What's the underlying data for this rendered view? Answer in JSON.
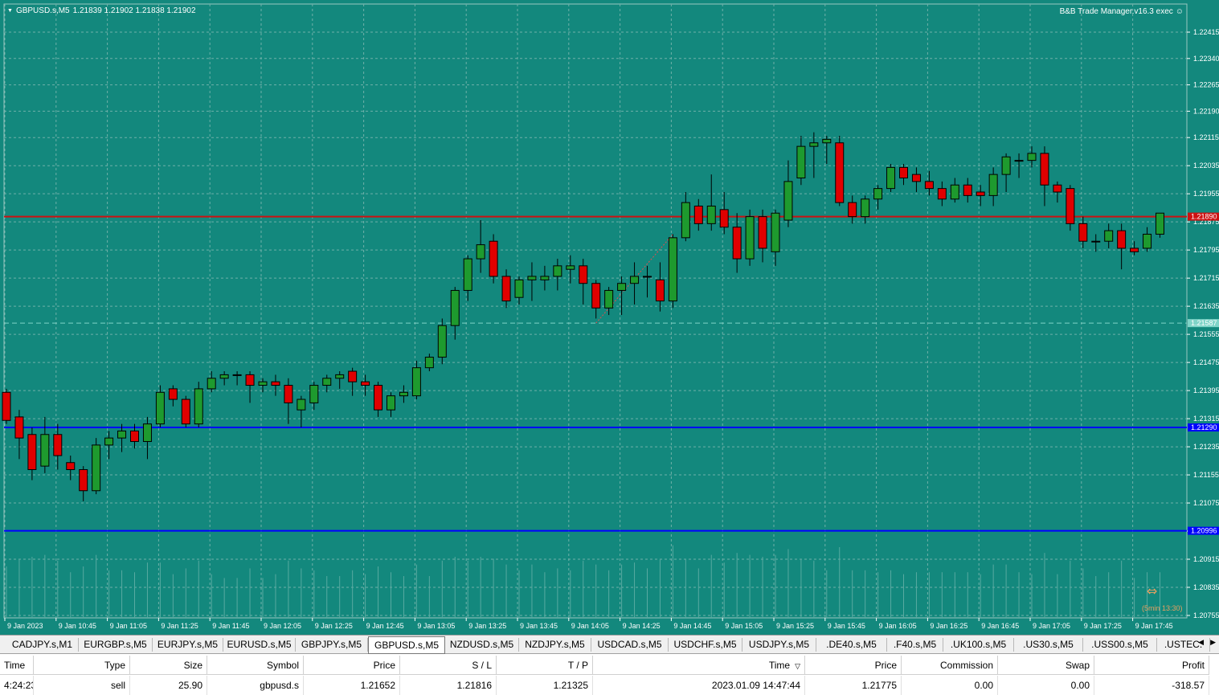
{
  "chart": {
    "symbol": "GBPUSD.s,M5",
    "ohlc": "1.21839 1.21902 1.21838 1.21902",
    "ea_label": "B&B Trade Manager.v16.3 exec",
    "ea_icon": "smiley-icon",
    "bg_color": "#13887d",
    "bull_color": "#1e9a2e",
    "bear_color": "#e00000",
    "countdown": "(5min 13:30)",
    "price_axis_labels": [
      "1.22415",
      "1.22340",
      "1.22265",
      "1.22190",
      "1.22115",
      "1.22035",
      "1.21955",
      "1.21875",
      "1.21795",
      "1.21715",
      "1.21635",
      "1.21555",
      "1.21475",
      "1.21395",
      "1.21315",
      "1.21235",
      "1.21155",
      "1.21075",
      "1.20995",
      "1.20915",
      "1.20835",
      "1.20755"
    ],
    "time_labels": [
      "9 Jan 2023",
      "9 Jan 10:45",
      "9 Jan 11:05",
      "9 Jan 11:25",
      "9 Jan 11:45",
      "9 Jan 12:05",
      "9 Jan 12:25",
      "9 Jan 12:45",
      "9 Jan 13:05",
      "9 Jan 13:25",
      "9 Jan 13:45",
      "9 Jan 14:05",
      "9 Jan 14:25",
      "9 Jan 14:45",
      "9 Jan 15:05",
      "9 Jan 15:25",
      "9 Jan 15:45",
      "9 Jan 16:05",
      "9 Jan 16:25",
      "9 Jan 16:45",
      "9 Jan 17:05",
      "9 Jan 17:25",
      "9 Jan 17:45"
    ],
    "lines": [
      {
        "name": "stop-loss-line",
        "price_label": "1.21890",
        "color": "#cc1111"
      },
      {
        "name": "entry-line",
        "price_label": "1.21587",
        "color": "#7fd4c8"
      },
      {
        "name": "level-line-1",
        "price_label": "1.21290",
        "color": "#0000ff"
      },
      {
        "name": "level-line-2",
        "price_label": "1.20996",
        "color": "#0000ff"
      }
    ]
  },
  "chart_data": {
    "type": "candlestick",
    "timeframe": "M5",
    "x_start": "9 Jan 10:20",
    "ylim": [
      1.2073,
      1.2249
    ],
    "candles": [
      [
        1.2139,
        1.214,
        1.213,
        1.2131
      ],
      [
        1.2132,
        1.2134,
        1.212,
        1.2126
      ],
      [
        1.2127,
        1.2129,
        1.2114,
        1.2117
      ],
      [
        1.2118,
        1.2132,
        1.2116,
        1.2127
      ],
      [
        1.2127,
        1.213,
        1.2117,
        1.2121
      ],
      [
        1.2119,
        1.2121,
        1.2114,
        1.2117
      ],
      [
        1.2117,
        1.2118,
        1.2108,
        1.2111
      ],
      [
        1.2111,
        1.2126,
        1.211,
        1.2124
      ],
      [
        1.2124,
        1.2128,
        1.212,
        1.2126
      ],
      [
        1.2126,
        1.213,
        1.2122,
        1.2128
      ],
      [
        1.2128,
        1.213,
        1.2123,
        1.2125
      ],
      [
        1.2125,
        1.2132,
        1.212,
        1.213
      ],
      [
        1.213,
        1.2141,
        1.2129,
        1.2139
      ],
      [
        1.214,
        1.2141,
        1.2135,
        1.2137
      ],
      [
        1.2137,
        1.2138,
        1.2129,
        1.213
      ],
      [
        1.213,
        1.2142,
        1.2129,
        1.214
      ],
      [
        1.214,
        1.2145,
        1.2139,
        1.2143
      ],
      [
        1.2143,
        1.2145,
        1.2141,
        1.2144
      ],
      [
        1.2144,
        1.2145,
        1.2141,
        1.2144
      ],
      [
        1.2144,
        1.2145,
        1.2136,
        1.2141
      ],
      [
        1.2141,
        1.2143,
        1.2139,
        1.2142
      ],
      [
        1.2142,
        1.2144,
        1.2138,
        1.2141
      ],
      [
        1.2141,
        1.2143,
        1.213,
        1.2136
      ],
      [
        1.2134,
        1.2138,
        1.2129,
        1.2137
      ],
      [
        1.2136,
        1.2142,
        1.2134,
        1.2141
      ],
      [
        1.2141,
        1.2144,
        1.2139,
        1.2143
      ],
      [
        1.2143,
        1.2145,
        1.214,
        1.2144
      ],
      [
        1.2145,
        1.2146,
        1.2138,
        1.2142
      ],
      [
        1.2142,
        1.2144,
        1.2138,
        1.2141
      ],
      [
        1.2141,
        1.2142,
        1.2132,
        1.2134
      ],
      [
        1.2134,
        1.2139,
        1.2132,
        1.2138
      ],
      [
        1.2138,
        1.2141,
        1.2136,
        1.2139
      ],
      [
        1.2138,
        1.2148,
        1.2137,
        1.2146
      ],
      [
        1.2146,
        1.215,
        1.2145,
        1.2149
      ],
      [
        1.2149,
        1.216,
        1.2147,
        1.2158
      ],
      [
        1.2158,
        1.2169,
        1.2154,
        1.2168
      ],
      [
        1.2168,
        1.2178,
        1.2165,
        1.2177
      ],
      [
        1.2177,
        1.2188,
        1.2173,
        1.2181
      ],
      [
        1.2182,
        1.2184,
        1.217,
        1.2172
      ],
      [
        1.2172,
        1.2174,
        1.2163,
        1.2165
      ],
      [
        1.2166,
        1.2172,
        1.2164,
        1.2171
      ],
      [
        1.2171,
        1.2176,
        1.2165,
        1.2172
      ],
      [
        1.2171,
        1.2175,
        1.2168,
        1.2172
      ],
      [
        1.2172,
        1.2177,
        1.2168,
        1.2175
      ],
      [
        1.2174,
        1.2178,
        1.217,
        1.2175
      ],
      [
        1.2175,
        1.2177,
        1.2164,
        1.217
      ],
      [
        1.217,
        1.2171,
        1.216,
        1.2163
      ],
      [
        1.2163,
        1.2169,
        1.2161,
        1.2168
      ],
      [
        1.2168,
        1.2172,
        1.2161,
        1.217
      ],
      [
        1.217,
        1.2176,
        1.2164,
        1.2172
      ],
      [
        1.2172,
        1.2175,
        1.2166,
        1.2172
      ],
      [
        1.2171,
        1.2176,
        1.2162,
        1.2165
      ],
      [
        1.2165,
        1.2184,
        1.2163,
        1.2183
      ],
      [
        1.2183,
        1.2196,
        1.2182,
        1.2193
      ],
      [
        1.2192,
        1.2194,
        1.2185,
        1.2187
      ],
      [
        1.2187,
        1.2201,
        1.2185,
        1.2192
      ],
      [
        1.2191,
        1.2196,
        1.2184,
        1.2186
      ],
      [
        1.2186,
        1.219,
        1.2173,
        1.2177
      ],
      [
        1.2177,
        1.2191,
        1.2175,
        1.2189
      ],
      [
        1.2189,
        1.2191,
        1.2176,
        1.218
      ],
      [
        1.2179,
        1.2191,
        1.2175,
        1.219
      ],
      [
        1.2188,
        1.2205,
        1.2186,
        1.2199
      ],
      [
        1.22,
        1.2212,
        1.2198,
        1.2209
      ],
      [
        1.2209,
        1.2213,
        1.22,
        1.221
      ],
      [
        1.221,
        1.2212,
        1.2204,
        1.2211
      ],
      [
        1.221,
        1.2212,
        1.2192,
        1.2193
      ],
      [
        1.2193,
        1.2195,
        1.2187,
        1.2189
      ],
      [
        1.2189,
        1.2195,
        1.2187,
        1.2194
      ],
      [
        1.2194,
        1.2198,
        1.2191,
        1.2197
      ],
      [
        1.2197,
        1.2204,
        1.2196,
        1.2203
      ],
      [
        1.2203,
        1.2204,
        1.2198,
        1.22
      ],
      [
        1.2201,
        1.2203,
        1.2196,
        1.2199
      ],
      [
        1.2199,
        1.2202,
        1.2195,
        1.2197
      ],
      [
        1.2197,
        1.2199,
        1.2192,
        1.2194
      ],
      [
        1.2194,
        1.22,
        1.2193,
        1.2198
      ],
      [
        1.2198,
        1.22,
        1.2193,
        1.2195
      ],
      [
        1.2196,
        1.2198,
        1.2192,
        1.2195
      ],
      [
        1.2195,
        1.2203,
        1.2192,
        1.2201
      ],
      [
        1.2201,
        1.2207,
        1.2196,
        1.2206
      ],
      [
        1.2205,
        1.2207,
        1.22,
        1.2205
      ],
      [
        1.2205,
        1.2209,
        1.2203,
        1.2207
      ],
      [
        1.2207,
        1.2209,
        1.2192,
        1.2198
      ],
      [
        1.2198,
        1.2199,
        1.2193,
        1.2196
      ],
      [
        1.2197,
        1.2198,
        1.2185,
        1.2187
      ],
      [
        1.2187,
        1.2189,
        1.218,
        1.2182
      ],
      [
        1.2182,
        1.2184,
        1.2179,
        1.2182
      ],
      [
        1.2182,
        1.2187,
        1.218,
        1.2185
      ],
      [
        1.2185,
        1.2187,
        1.2174,
        1.218
      ],
      [
        1.218,
        1.2182,
        1.2178,
        1.2179
      ],
      [
        1.218,
        1.2186,
        1.2179,
        1.2184
      ],
      [
        1.2184,
        1.219,
        1.2183,
        1.219
      ]
    ]
  },
  "tabs": [
    "CADJPY.s,M1",
    "EURGBP.s,M5",
    "EURJPY.s,M5",
    "EURUSD.s,M5",
    "GBPJPY.s,M5",
    "GBPUSD.s,M5",
    "NZDUSD.s,M5",
    "NZDJPY.s,M5",
    "USDCAD.s,M5",
    "USDCHF.s,M5",
    "USDJPY.s,M5",
    ".DE40.s,M5",
    ".F40.s,M5",
    ".UK100.s,M5",
    ".US30.s,M5",
    ".USS00.s,M5",
    ".USTEC."
  ],
  "active_tab": "GBPUSD.s,M5",
  "table": {
    "headers": [
      "Time",
      "Type",
      "Size",
      "Symbol",
      "Price",
      "S / L",
      "T / P",
      "Time",
      "Price",
      "Commission",
      "Swap",
      "Profit"
    ],
    "sort_indicator": "▽",
    "row": [
      "4:24:23",
      "sell",
      "25.90",
      "gbpusd.s",
      "1.21652",
      "1.21816",
      "1.21325",
      "2023.01.09 14:47:44",
      "1.21775",
      "0.00",
      "0.00",
      "-318.57"
    ]
  }
}
